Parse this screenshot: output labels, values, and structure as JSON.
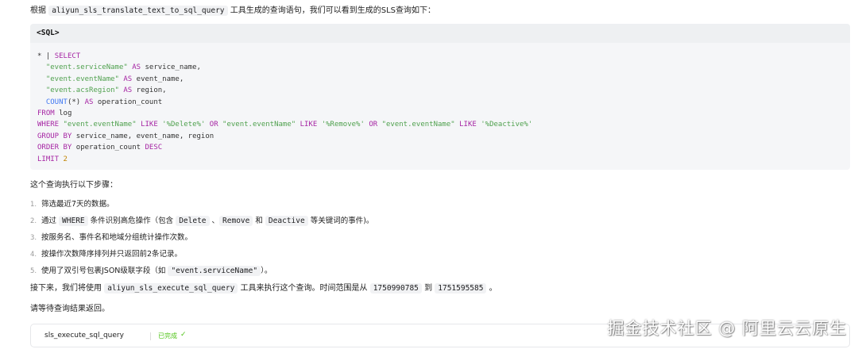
{
  "intro": {
    "prefix": "根据",
    "tool": "aliyun_sls_translate_text_to_sql_query",
    "suffix": "工具生成的查询语句，我们可以看到生成的SLS查询如下："
  },
  "code_block": {
    "header": "<SQL>",
    "lines": [
      [
        {
          "t": "* | ",
          "c": "plain"
        },
        {
          "t": "SELECT",
          "c": "kw"
        }
      ],
      [
        {
          "t": "  ",
          "c": "plain"
        },
        {
          "t": "\"event.serviceName\"",
          "c": "str"
        },
        {
          "t": " ",
          "c": "plain"
        },
        {
          "t": "AS",
          "c": "kw"
        },
        {
          "t": " service_name,",
          "c": "plain"
        }
      ],
      [
        {
          "t": "  ",
          "c": "plain"
        },
        {
          "t": "\"event.eventName\"",
          "c": "str"
        },
        {
          "t": " ",
          "c": "plain"
        },
        {
          "t": "AS",
          "c": "kw"
        },
        {
          "t": " event_name,",
          "c": "plain"
        }
      ],
      [
        {
          "t": "  ",
          "c": "plain"
        },
        {
          "t": "\"event.acsRegion\"",
          "c": "str"
        },
        {
          "t": " ",
          "c": "plain"
        },
        {
          "t": "AS",
          "c": "kw"
        },
        {
          "t": " region,",
          "c": "plain"
        }
      ],
      [
        {
          "t": "  ",
          "c": "plain"
        },
        {
          "t": "COUNT",
          "c": "fn"
        },
        {
          "t": "(*) ",
          "c": "plain"
        },
        {
          "t": "AS",
          "c": "kw"
        },
        {
          "t": " operation_count",
          "c": "plain"
        }
      ],
      [
        {
          "t": "FROM",
          "c": "kw"
        },
        {
          "t": " log",
          "c": "plain"
        }
      ],
      [
        {
          "t": "WHERE",
          "c": "kw"
        },
        {
          "t": " ",
          "c": "plain"
        },
        {
          "t": "\"event.eventName\"",
          "c": "str"
        },
        {
          "t": " ",
          "c": "plain"
        },
        {
          "t": "LIKE",
          "c": "kw"
        },
        {
          "t": " ",
          "c": "plain"
        },
        {
          "t": "'%Delete%'",
          "c": "str"
        },
        {
          "t": " ",
          "c": "plain"
        },
        {
          "t": "OR",
          "c": "kw"
        },
        {
          "t": " ",
          "c": "plain"
        },
        {
          "t": "\"event.eventName\"",
          "c": "str"
        },
        {
          "t": " ",
          "c": "plain"
        },
        {
          "t": "LIKE",
          "c": "kw"
        },
        {
          "t": " ",
          "c": "plain"
        },
        {
          "t": "'%Remove%'",
          "c": "str"
        },
        {
          "t": " ",
          "c": "plain"
        },
        {
          "t": "OR",
          "c": "kw"
        },
        {
          "t": " ",
          "c": "plain"
        },
        {
          "t": "\"event.eventName\"",
          "c": "str"
        },
        {
          "t": " ",
          "c": "plain"
        },
        {
          "t": "LIKE",
          "c": "kw"
        },
        {
          "t": " ",
          "c": "plain"
        },
        {
          "t": "'%Deactive%'",
          "c": "str"
        }
      ],
      [
        {
          "t": "GROUP BY",
          "c": "kw"
        },
        {
          "t": " service_name, event_name, region",
          "c": "plain"
        }
      ],
      [
        {
          "t": "ORDER BY",
          "c": "kw"
        },
        {
          "t": " operation_count ",
          "c": "plain"
        },
        {
          "t": "DESC",
          "c": "kw"
        }
      ],
      [
        {
          "t": "LIMIT",
          "c": "kw"
        },
        {
          "t": " ",
          "c": "plain"
        },
        {
          "t": "2",
          "c": "num"
        }
      ]
    ]
  },
  "steps_title": "这个查询执行以下步骤：",
  "steps": [
    {
      "num": "1.",
      "parts": [
        {
          "t": "筛选最近7天的数据。",
          "code": false
        }
      ]
    },
    {
      "num": "2.",
      "parts": [
        {
          "t": "通过 ",
          "code": false
        },
        {
          "t": "WHERE",
          "code": true
        },
        {
          "t": " 条件识别高危操作（包含 ",
          "code": false
        },
        {
          "t": "Delete",
          "code": true
        },
        {
          "t": " 、",
          "code": false
        },
        {
          "t": "Remove",
          "code": true
        },
        {
          "t": " 和 ",
          "code": false
        },
        {
          "t": "Deactive",
          "code": true
        },
        {
          "t": " 等关键词的事件)。",
          "code": false
        }
      ]
    },
    {
      "num": "3.",
      "parts": [
        {
          "t": "按服务名、事件名和地域分组统计操作次数。",
          "code": false
        }
      ]
    },
    {
      "num": "4.",
      "parts": [
        {
          "t": "按操作次数降序排列并只返回前2条记录。",
          "code": false
        }
      ]
    },
    {
      "num": "5.",
      "parts": [
        {
          "t": "使用了双引号包裹JSON级联字段（如 ",
          "code": false
        },
        {
          "t": "\"event.serviceName\"",
          "code": true
        },
        {
          "t": "）。",
          "code": false
        }
      ]
    }
  ],
  "next": {
    "p1": "接下来，我们将使用 ",
    "tool": "aliyun_sls_execute_sql_query",
    "p2": " 工具来执行这个查询。时间范围是从 ",
    "from": "1750990785",
    "p3": " 到 ",
    "to": "1751595585",
    "p4": " 。"
  },
  "wait": "请等待查询结果返回。",
  "tool_card": {
    "name": "sls_execute_sql_query",
    "status": "已完成",
    "icon": "check-icon",
    "status_color": "#52c41a"
  },
  "watermark": "掘金技术社区 @ 阿里云云原生"
}
